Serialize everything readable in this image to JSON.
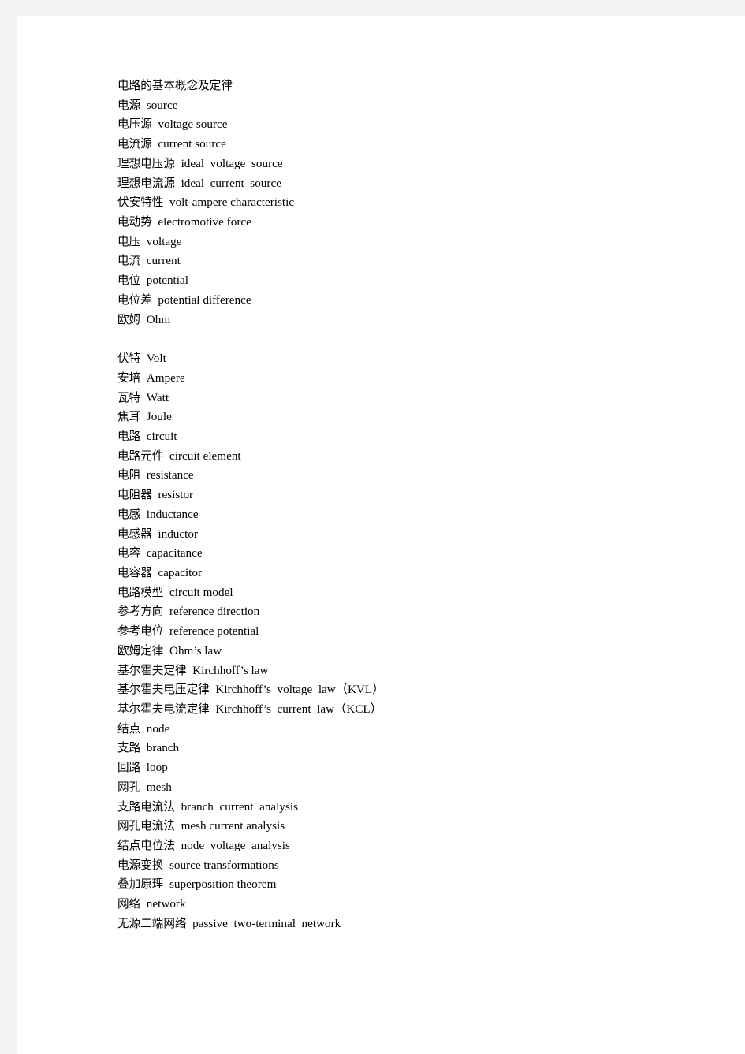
{
  "document": {
    "title": "电路的基本概念及定律",
    "page_background": "#ffffff",
    "margin_background": "#f4f4f4",
    "text_color": "#000000"
  },
  "glossary": {
    "heading": "电路的基本概念及定律",
    "entries": [
      {
        "zh": "电路的基本概念及定律",
        "en": "",
        "type": "heading"
      },
      {
        "zh": "电源",
        "en": "source",
        "type": "entry"
      },
      {
        "zh": "电压源",
        "en": "voltage source",
        "type": "entry"
      },
      {
        "zh": "电流源",
        "en": "current source",
        "type": "entry"
      },
      {
        "zh": "理想电压源",
        "en": "ideal  voltage  source",
        "type": "entry"
      },
      {
        "zh": "理想电流源",
        "en": "ideal  current  source",
        "type": "entry"
      },
      {
        "zh": "伏安特性",
        "en": "volt-ampere characteristic",
        "type": "entry"
      },
      {
        "zh": "电动势",
        "en": "electromotive force",
        "type": "entry"
      },
      {
        "zh": "电压",
        "en": "voltage",
        "type": "entry"
      },
      {
        "zh": "电流",
        "en": "current",
        "type": "entry"
      },
      {
        "zh": "电位",
        "en": "potential",
        "type": "entry"
      },
      {
        "zh": "电位差",
        "en": "potential difference",
        "type": "entry"
      },
      {
        "zh": "欧姆",
        "en": "Ohm",
        "type": "entry"
      },
      {
        "zh": "",
        "en": "",
        "type": "blank"
      },
      {
        "zh": "伏特",
        "en": "Volt",
        "type": "entry"
      },
      {
        "zh": "安培",
        "en": "Ampere",
        "type": "entry"
      },
      {
        "zh": "瓦特",
        "en": "Watt",
        "type": "entry"
      },
      {
        "zh": "焦耳",
        "en": "Joule",
        "type": "entry"
      },
      {
        "zh": "电路",
        "en": "circuit",
        "type": "entry"
      },
      {
        "zh": "电路元件",
        "en": "circuit element",
        "type": "entry"
      },
      {
        "zh": "电阻",
        "en": "resistance",
        "type": "entry"
      },
      {
        "zh": "电阻器",
        "en": "resistor",
        "type": "entry"
      },
      {
        "zh": "电感",
        "en": "inductance",
        "type": "entry"
      },
      {
        "zh": "电感器",
        "en": "inductor",
        "type": "entry"
      },
      {
        "zh": "电容",
        "en": "capacitance",
        "type": "entry"
      },
      {
        "zh": "电容器",
        "en": "capacitor",
        "type": "entry"
      },
      {
        "zh": "电路模型",
        "en": "circuit model",
        "type": "entry"
      },
      {
        "zh": "参考方向",
        "en": "reference direction",
        "type": "entry"
      },
      {
        "zh": "参考电位",
        "en": "reference potential",
        "type": "entry"
      },
      {
        "zh": "欧姆定律",
        "en": "Ohm’s law",
        "type": "entry"
      },
      {
        "zh": "基尔霍夫定律",
        "en": "Kirchhoff’s law",
        "type": "entry"
      },
      {
        "zh": "基尔霍夫电压定律",
        "en": "Kirchhoff’s  voltage  law（KVL）",
        "type": "entry"
      },
      {
        "zh": "基尔霍夫电流定律",
        "en": "Kirchhoff’s  current  law（KCL）",
        "type": "entry"
      },
      {
        "zh": "结点",
        "en": "node",
        "type": "entry"
      },
      {
        "zh": "支路",
        "en": "branch",
        "type": "entry"
      },
      {
        "zh": "回路",
        "en": "loop",
        "type": "entry"
      },
      {
        "zh": "网孔",
        "en": "mesh",
        "type": "entry"
      },
      {
        "zh": "支路电流法",
        "en": "branch  current  analysis",
        "type": "entry"
      },
      {
        "zh": "网孔电流法",
        "en": "mesh current analysis",
        "type": "entry"
      },
      {
        "zh": "结点电位法",
        "en": "node  voltage  analysis",
        "type": "entry"
      },
      {
        "zh": "电源变换",
        "en": "source transformations",
        "type": "entry"
      },
      {
        "zh": "叠加原理",
        "en": "superposition theorem",
        "type": "entry"
      },
      {
        "zh": "网络",
        "en": "network",
        "type": "entry"
      },
      {
        "zh": "无源二端网络",
        "en": "passive  two-terminal  network",
        "type": "entry"
      }
    ]
  }
}
